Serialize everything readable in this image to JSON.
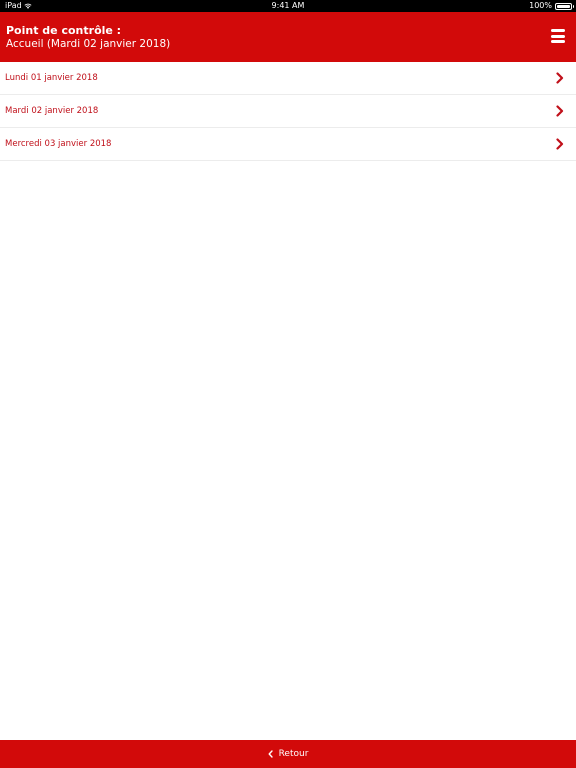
{
  "status_bar": {
    "device": "iPad",
    "time": "9:41 AM",
    "battery": "100%"
  },
  "header": {
    "title": "Point de contrôle :",
    "subtitle": "Accueil (Mardi 02 janvier 2018)"
  },
  "list": {
    "items": [
      {
        "label": "Lundi 01 janvier 2018"
      },
      {
        "label": "Mardi 02 janvier 2018"
      },
      {
        "label": "Mercredi 03 janvier 2018"
      }
    ]
  },
  "footer": {
    "back_label": "Retour"
  },
  "colors": {
    "brand_red": "#d20a0a",
    "item_text": "#c0101a"
  },
  "icons": {
    "menu": "hamburger-menu-icon",
    "item_arrow": "chevron-right-icon",
    "back": "chevron-left-icon",
    "wifi": "wifi-icon",
    "battery": "battery-icon"
  }
}
